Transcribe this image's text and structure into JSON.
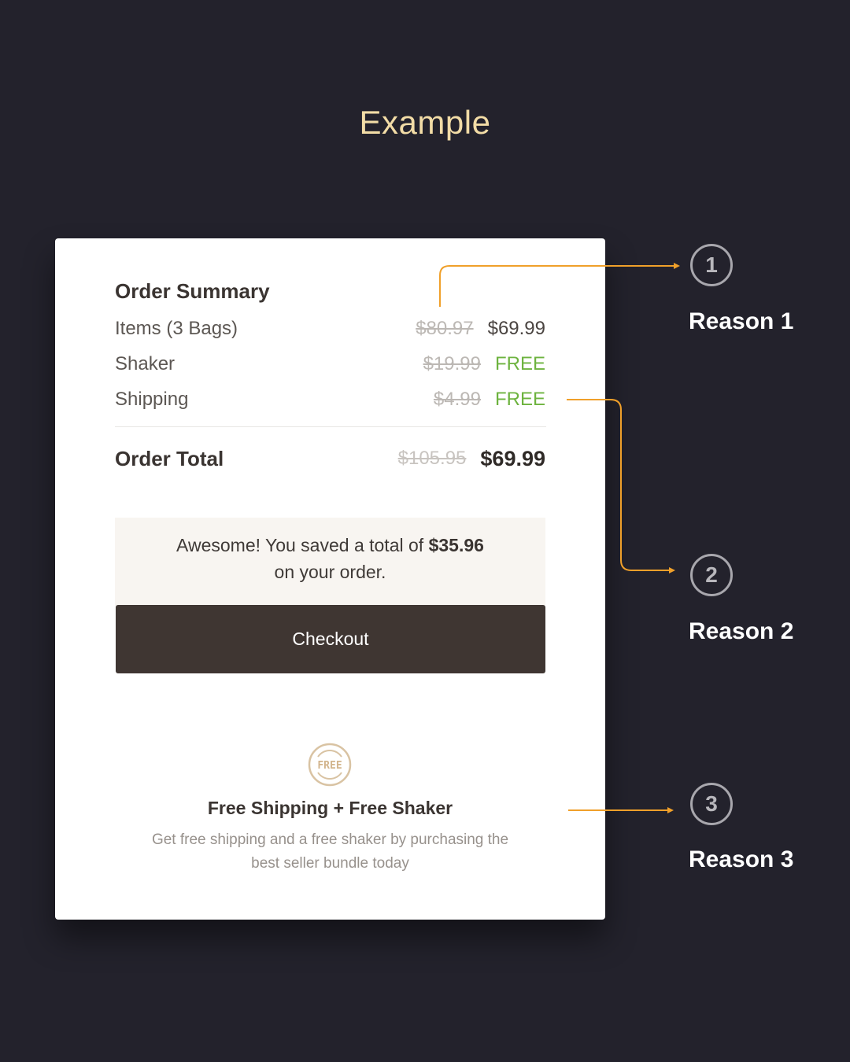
{
  "heading": "Example",
  "order": {
    "title": "Order Summary",
    "items": [
      {
        "label": "Items (3 Bags)",
        "old": "$80.97",
        "new": "$69.99"
      },
      {
        "label": "Shaker",
        "old": "$19.99",
        "new": "FREE"
      },
      {
        "label": "Shipping",
        "old": "$4.99",
        "new": "FREE"
      }
    ],
    "total": {
      "label": "Order Total",
      "old": "$105.95",
      "new": "$69.99"
    },
    "savings": {
      "prefix": "Awesome! You saved a total of ",
      "amount": "$35.96",
      "suffix": "on your order."
    },
    "checkout_label": "Checkout",
    "badge_text": "FREE",
    "promo_title": "Free Shipping + Free Shaker",
    "promo_desc_line1": "Get free shipping and a free shaker by purchasing the",
    "promo_desc_line2": "best seller bundle today"
  },
  "callouts": [
    {
      "number": "1",
      "label": "Reason 1"
    },
    {
      "number": "2",
      "label": "Reason 2"
    },
    {
      "number": "3",
      "label": "Reason 3"
    }
  ],
  "colors": {
    "background": "#23222c",
    "heading": "#f2dca6",
    "accent_line": "#f0a02a",
    "free_green": "#6db33f",
    "checkout_bg": "#3f3632"
  }
}
